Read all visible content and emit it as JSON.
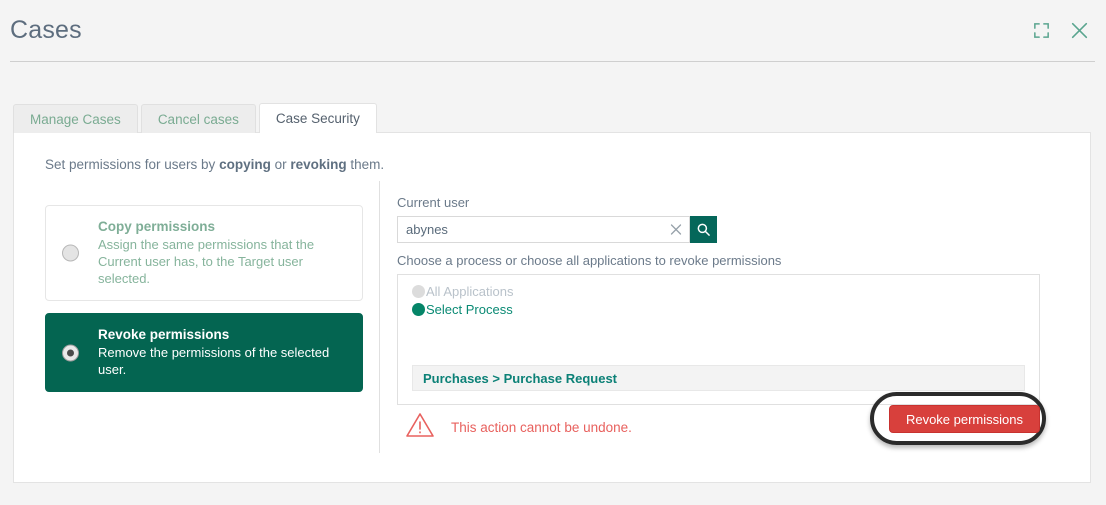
{
  "header": {
    "title": "Cases",
    "expand_icon": "expand-icon",
    "close_icon": "close-icon"
  },
  "tabs": [
    {
      "label": "Manage Cases",
      "active": false
    },
    {
      "label": "Cancel cases",
      "active": false
    },
    {
      "label": "Case Security",
      "active": true
    }
  ],
  "main": {
    "intro": {
      "before": "Set permissions for users by ",
      "bold1": "copying",
      "middle": " or ",
      "bold2": "revoking",
      "after": " them."
    },
    "modes": [
      {
        "title": "Copy permissions",
        "description": "Assign the same permissions that the Current user has, to the Target user selected.",
        "selected": false
      },
      {
        "title": "Revoke permissions",
        "description": "Remove the permissions of the selected user.",
        "selected": true
      }
    ],
    "current_user": {
      "label": "Current user",
      "value": "abynes",
      "placeholder": "",
      "clear_icon": "close-icon",
      "search_icon": "search-icon"
    },
    "process_section": {
      "hint": "Choose a process or choose all applications to revoke permissions",
      "scopes": [
        {
          "label": "All Applications",
          "selected": false
        },
        {
          "label": "Select Process",
          "selected": true
        }
      ],
      "selected_process": "Purchases > Purchase Request"
    },
    "footer": {
      "warning_icon": "warning-triangle-icon",
      "warning_text": "This action cannot be undone.",
      "revoke_button": "Revoke permissions"
    }
  },
  "colors": {
    "page_background": "#f4f4f4",
    "accent_teal": "#046551",
    "tab_text_green": "#7aab92",
    "danger_red": "#d8403c",
    "warning_red": "#e8615e",
    "highlight_ring": "#2b2b2b"
  }
}
